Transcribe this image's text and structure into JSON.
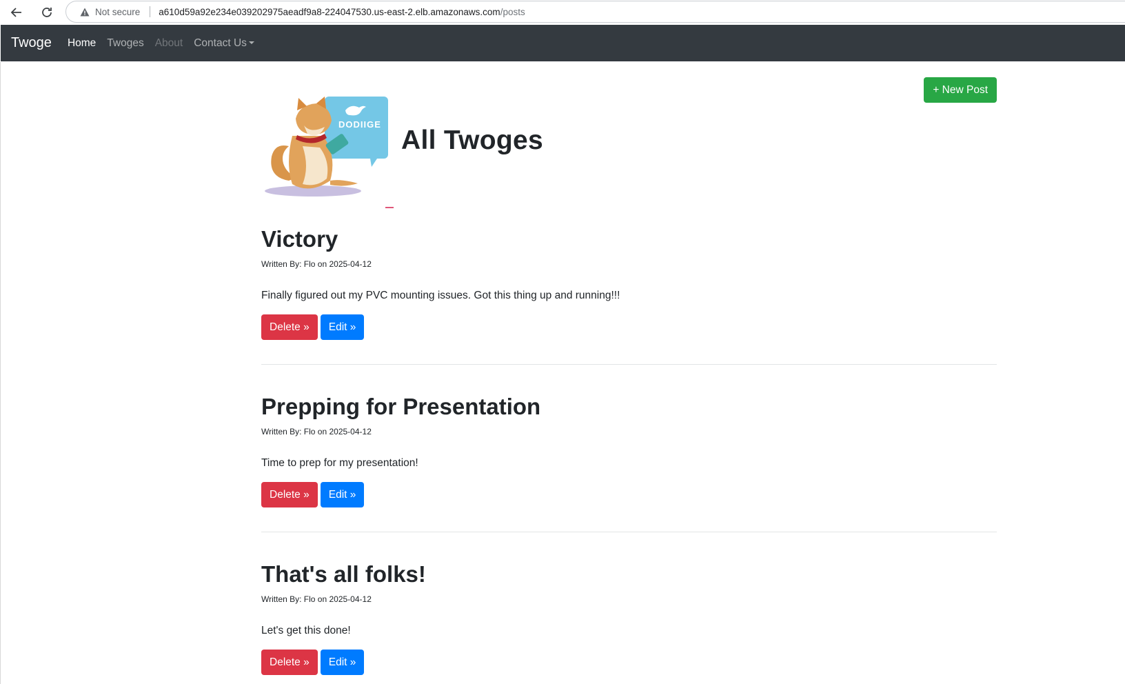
{
  "browser": {
    "security_label": "Not secure",
    "url_host": "a610d59a92e234e039202975aeadf9a8-224047530.us-east-2.elb.amazonaws.com",
    "url_path": "/posts"
  },
  "navbar": {
    "brand": "Twoge",
    "links": [
      {
        "label": "Home"
      },
      {
        "label": "Twoges"
      },
      {
        "label": "About"
      },
      {
        "label": "Contact Us"
      }
    ]
  },
  "header": {
    "title": "All Twoges",
    "new_post_label": "+ New Post",
    "logo_text": "DODIIGE"
  },
  "posts": [
    {
      "title": "Victory",
      "meta": "Written By: Flo on 2025-04-12",
      "body": "Finally figured out my PVC mounting issues. Got this thing up and running!!!",
      "delete_label": "Delete »",
      "edit_label": "Edit »"
    },
    {
      "title": "Prepping for Presentation",
      "meta": "Written By: Flo on 2025-04-12",
      "body": "Time to prep for my presentation!",
      "delete_label": "Delete »",
      "edit_label": "Edit »"
    },
    {
      "title": "That's all folks!",
      "meta": "Written By: Flo on 2025-04-12",
      "body": "Let's get this done!",
      "delete_label": "Delete »",
      "edit_label": "Edit »"
    }
  ],
  "colors": {
    "navbar_bg": "#343a40",
    "success": "#28a745",
    "danger": "#dc3545",
    "primary": "#007bff"
  }
}
